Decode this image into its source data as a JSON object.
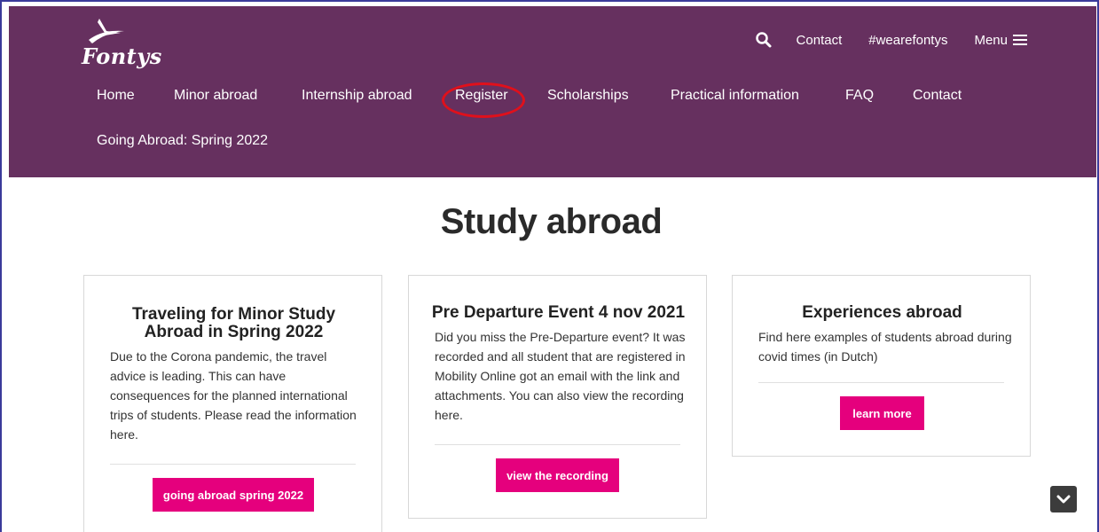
{
  "brand": {
    "logo_text": "Fontys"
  },
  "top_bar": {
    "contact": "Contact",
    "hashtag": "#wearefontys",
    "menu": "Menu"
  },
  "nav": {
    "items": [
      "Home",
      "Minor abroad",
      "Internship abroad",
      "Register",
      "Scholarships",
      "Practical information",
      "FAQ",
      "Contact"
    ],
    "second_row": "Going Abroad: Spring 2022"
  },
  "page": {
    "title": "Study abroad"
  },
  "cards": [
    {
      "title": "Traveling for Minor Study Abroad in Spring 2022",
      "text": "Due to the Corona pandemic, the travel advice is leading. This can have consequences for the planned international trips of students. Please read the information here.",
      "button": "going abroad spring 2022"
    },
    {
      "title": "Pre Departure Event 4 nov 2021",
      "text": "Did you miss the Pre-Departure event? It was recorded and all student that are registered in Mobility Online got an email with the link and attachments. You can also view the recording here.",
      "button": "view the recording"
    },
    {
      "title": "Experiences abroad",
      "text": "Find here examples of students abroad during covid times (in Dutch)",
      "button": "learn more"
    }
  ],
  "colors": {
    "header": "#66305f",
    "accent": "#e5007d",
    "highlight": "#e0101b"
  },
  "icons": {
    "search": "search-icon",
    "menu": "hamburger-icon",
    "scroll": "chevron-down-icon"
  }
}
